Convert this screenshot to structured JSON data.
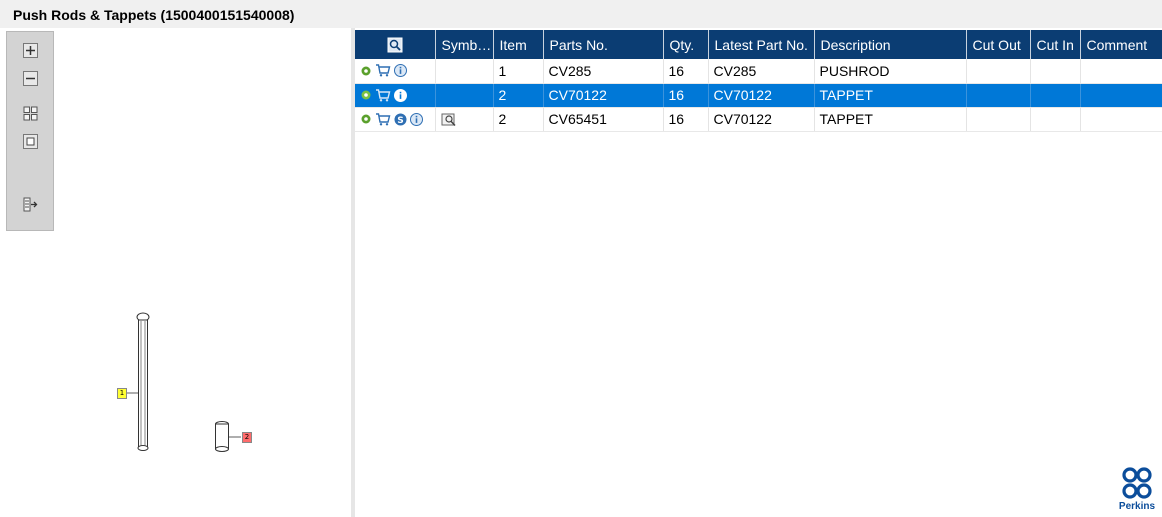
{
  "title": "Push Rods & Tappets (1500400151540008)",
  "toolbar": {
    "buttons": [
      "zoom-in",
      "zoom-out",
      "fit-all",
      "fit-window",
      "export"
    ]
  },
  "drawing": {
    "callouts": [
      {
        "label": "1",
        "color": "#ffff33"
      },
      {
        "label": "2",
        "color": "#ff6b6b"
      }
    ]
  },
  "table": {
    "headers": {
      "symbols": "Symb…",
      "item": "Item",
      "parts_no": "Parts No.",
      "qty": "Qty.",
      "latest_part_no": "Latest Part No.",
      "description": "Description",
      "cut_out": "Cut Out",
      "cut_in": "Cut In",
      "comment": "Comment"
    },
    "rows": [
      {
        "item": "1",
        "parts_no": "CV285",
        "qty": "16",
        "latest_part_no": "CV285",
        "description": "PUSHROD",
        "cut_out": "",
        "cut_in": "",
        "comment": "",
        "selected": false
      },
      {
        "item": "2",
        "parts_no": "CV70122",
        "qty": "16",
        "latest_part_no": "CV70122",
        "description": "TAPPET",
        "cut_out": "",
        "cut_in": "",
        "comment": "",
        "selected": true
      },
      {
        "item": "2",
        "parts_no": "CV65451",
        "qty": "16",
        "latest_part_no": "CV70122",
        "description": "TAPPET",
        "cut_out": "",
        "cut_in": "",
        "comment": "",
        "selected": false
      }
    ]
  },
  "brand": {
    "name": "Perkins",
    "color": "#0b4d9b",
    "header_color": "#0b3d73",
    "selection_color": "#0078d7"
  }
}
